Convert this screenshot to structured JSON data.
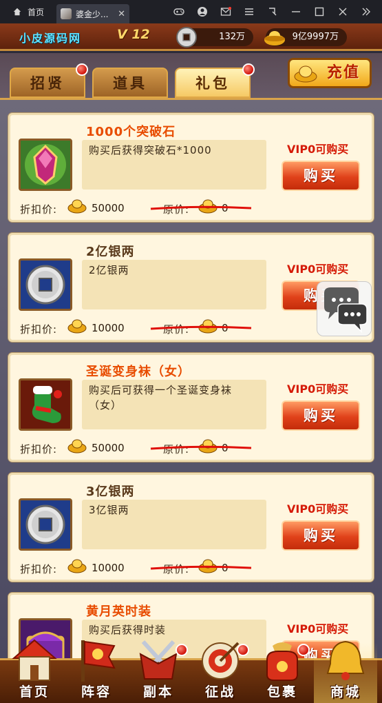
{
  "window": {
    "home_tab": "首页",
    "active_tab": "婆金少...",
    "close_glyph": "✕",
    "icons": [
      "home-icon",
      "gamepad-icon",
      "user-icon",
      "mail-icon",
      "menu-icon",
      "resize-icon",
      "minimize-icon",
      "maximize-icon",
      "close-icon",
      "collapse-icon"
    ]
  },
  "topbar": {
    "brand": "小皮源码网",
    "vip_level": "V 12",
    "coins": "132万",
    "gold": "9亿9997万"
  },
  "tabs": [
    {
      "label": "招贤",
      "badge": true
    },
    {
      "label": "道具",
      "badge": false
    },
    {
      "label": "礼包",
      "badge": true,
      "active": true
    }
  ],
  "recharge_label": "充值",
  "labels": {
    "discount": "折扣价:",
    "original": "原价:",
    "buy": "购买"
  },
  "cards": [
    {
      "title": "1000个突破石",
      "desc": "购买后获得突破石*1000",
      "vip": "VIP0可购买",
      "price": "50000",
      "original": "0",
      "icon": "breakthrough-stone-icon"
    },
    {
      "title": "2亿银两",
      "desc": "2亿银两",
      "vip": "VIP0可购买",
      "price": "10000",
      "original": "0",
      "icon": "silver-coin-icon"
    },
    {
      "title": "圣诞变身袜（女）",
      "desc": "购买后可获得一个圣诞变身袜（女）",
      "vip": "VIP0可购买",
      "price": "50000",
      "original": "0",
      "icon": "christmas-stocking-icon"
    },
    {
      "title": "3亿银两",
      "desc": "3亿银两",
      "vip": "VIP0可购买",
      "price": "10000",
      "original": "0",
      "icon": "silver-coin-icon"
    },
    {
      "title": "黄月英时装",
      "desc": "购买后获得时装",
      "vip": "VIP0可购买",
      "price": "",
      "original": "",
      "icon": "treasure-chest-icon"
    }
  ],
  "bottom_nav": [
    {
      "label": "首页",
      "icon": "home-house-icon",
      "badge": false
    },
    {
      "label": "阵容",
      "icon": "formation-flag-icon",
      "badge": false
    },
    {
      "label": "副本",
      "icon": "dungeon-swords-icon",
      "badge": true
    },
    {
      "label": "征战",
      "icon": "battle-target-icon",
      "badge": true
    },
    {
      "label": "包裹",
      "icon": "bag-icon",
      "badge": true
    },
    {
      "label": "商城",
      "icon": "shop-bell-icon",
      "badge": false,
      "active": true
    }
  ],
  "colors": {
    "accent_red": "#e84c00",
    "vip_red": "#d51a06",
    "brand_cyan": "#5fe3ff",
    "gold": "#f1a819"
  }
}
